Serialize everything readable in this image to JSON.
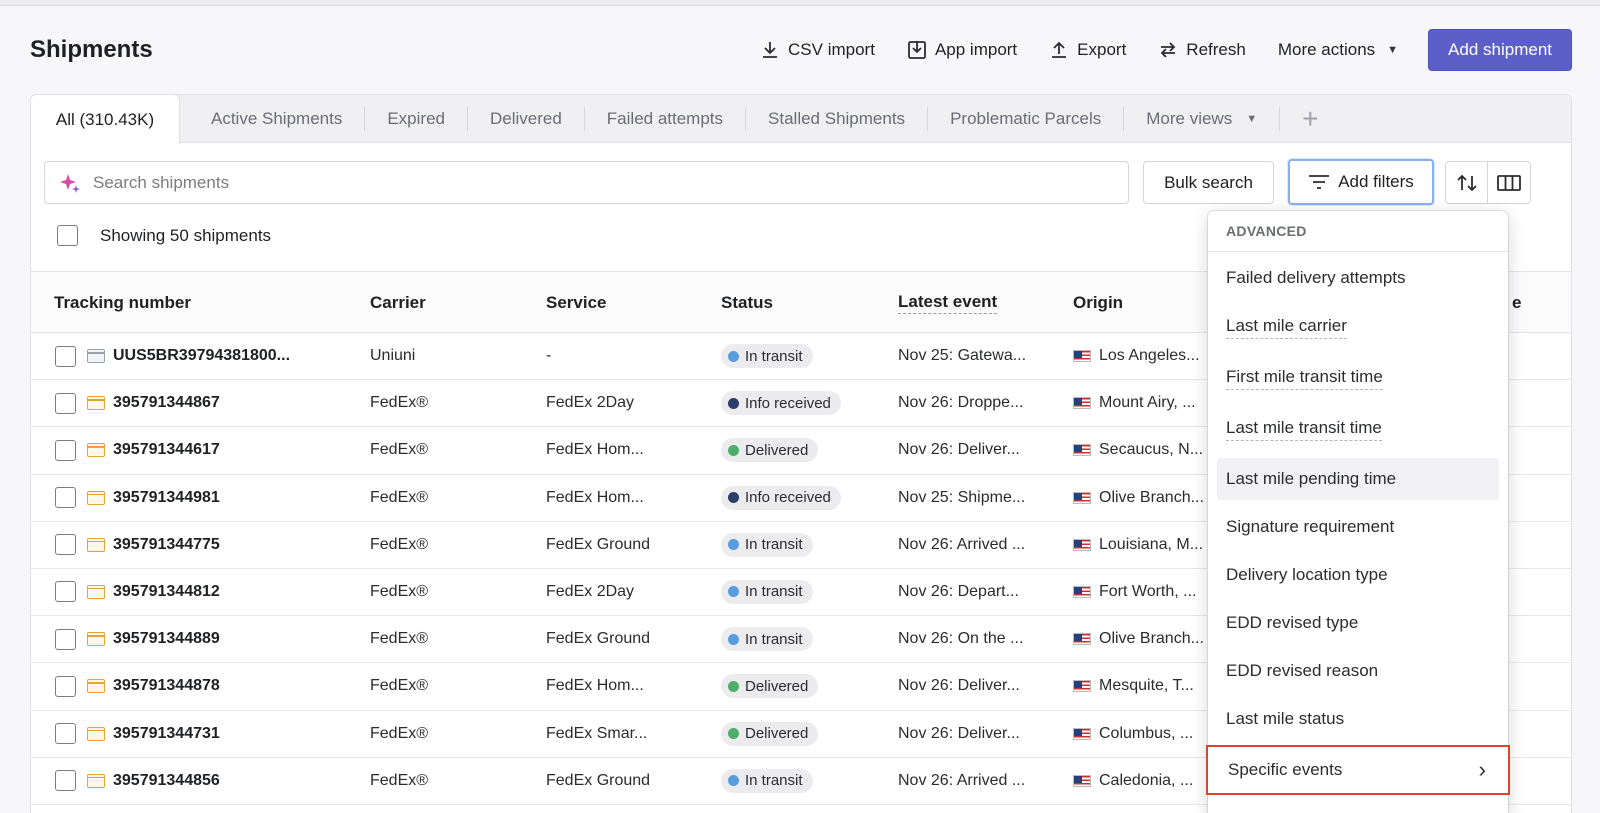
{
  "page": {
    "title": "Shipments"
  },
  "header": {
    "csv_import": "CSV import",
    "app_import": "App import",
    "export": "Export",
    "refresh": "Refresh",
    "more_actions": "More actions",
    "add_shipment": "Add shipment"
  },
  "tabs": {
    "active": "All (310.43K)",
    "items": [
      "Active Shipments",
      "Expired",
      "Delivered",
      "Failed attempts",
      "Stalled Shipments",
      "Problematic Parcels",
      "More views"
    ]
  },
  "toolbar": {
    "search_placeholder": "Search shipments",
    "bulk_search": "Bulk search",
    "add_filters": "Add filters"
  },
  "summary": {
    "showing": "Showing 50 shipments"
  },
  "table": {
    "columns": [
      "Tracking number",
      "Carrier",
      "Service",
      "Status",
      "Latest event",
      "Origin",
      "e"
    ],
    "rows": [
      {
        "tracking": "UUS5BR39794381800...",
        "source": "web",
        "carrier": "Uniuni",
        "service": "-",
        "status": "In transit",
        "event": "Nov 25: Gatewa...",
        "origin": "Los Angeles..."
      },
      {
        "tracking": "395791344867",
        "source": "api",
        "carrier": "FedEx®",
        "service": "FedEx 2Day",
        "status": "Info received",
        "event": "Nov 26: Droppe...",
        "origin": "Mount Airy, ..."
      },
      {
        "tracking": "395791344617",
        "source": "api",
        "carrier": "FedEx®",
        "service": "FedEx Hom...",
        "status": "Delivered",
        "event": "Nov 26: Deliver...",
        "origin": "Secaucus, N..."
      },
      {
        "tracking": "395791344981",
        "source": "api",
        "carrier": "FedEx®",
        "service": "FedEx Hom...",
        "status": "Info received",
        "event": "Nov 25: Shipme...",
        "origin": "Olive Branch..."
      },
      {
        "tracking": "395791344775",
        "source": "api",
        "carrier": "FedEx®",
        "service": "FedEx Ground",
        "status": "In transit",
        "event": "Nov 26: Arrived ...",
        "origin": "Louisiana, M..."
      },
      {
        "tracking": "395791344812",
        "source": "api",
        "carrier": "FedEx®",
        "service": "FedEx 2Day",
        "status": "In transit",
        "event": "Nov 26: Depart...",
        "origin": "Fort Worth, ..."
      },
      {
        "tracking": "395791344889",
        "source": "api",
        "carrier": "FedEx®",
        "service": "FedEx Ground",
        "status": "In transit",
        "event": "Nov 26: On the ...",
        "origin": "Olive Branch..."
      },
      {
        "tracking": "395791344878",
        "source": "api",
        "carrier": "FedEx®",
        "service": "FedEx Hom...",
        "status": "Delivered",
        "event": "Nov 26: Deliver...",
        "origin": "Mesquite, T..."
      },
      {
        "tracking": "395791344731",
        "source": "api",
        "carrier": "FedEx®",
        "service": "FedEx Smar...",
        "status": "Delivered",
        "event": "Nov 26: Deliver...",
        "origin": "Columbus, ..."
      },
      {
        "tracking": "395791344856",
        "source": "api",
        "carrier": "FedEx®",
        "service": "FedEx Ground",
        "status": "In transit",
        "event": "Nov 26: Arrived ...",
        "origin": "Caledonia, ..."
      }
    ],
    "status_colors": {
      "In transit": "#5b9be0",
      "Info received": "#2c3e6b",
      "Delivered": "#4caf6a"
    }
  },
  "dropdown": {
    "heading": "ADVANCED",
    "items": [
      "Failed delivery attempts",
      "Last mile carrier",
      "First mile transit time",
      "Last mile transit time",
      "Last mile pending time",
      "Signature requirement",
      "Delivery location type",
      "EDD revised type",
      "EDD revised reason",
      "Last mile status"
    ],
    "specific": "Specific events"
  },
  "colors": {
    "primary": "#5b5fc7",
    "highlight_border": "#e0432f",
    "focus_border": "#8ab0f0"
  }
}
